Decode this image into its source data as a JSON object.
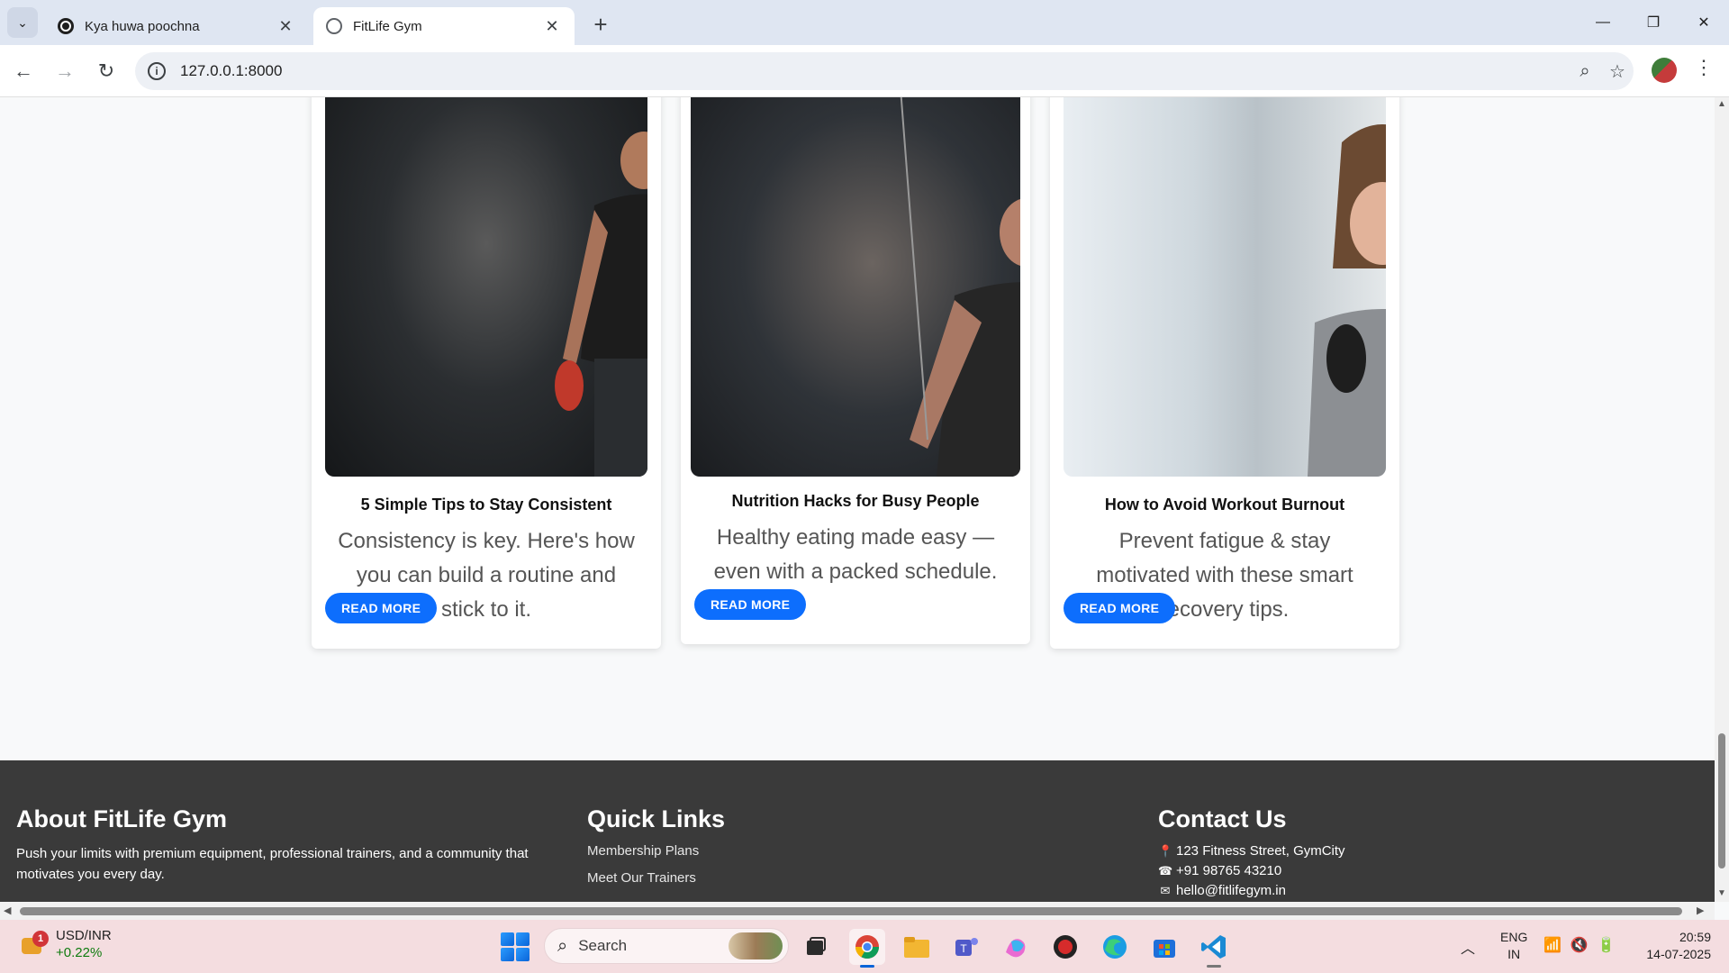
{
  "browser": {
    "tabs": [
      {
        "title": "Kya huwa poochna"
      },
      {
        "title": "FitLife Gym"
      }
    ],
    "url": "127.0.0.1:8000"
  },
  "blog_cards": [
    {
      "title": "5 Simple Tips to Stay Consistent",
      "text": "Consistency is key. Here's how you can build a routine and stick to it.",
      "button": "READ MORE"
    },
    {
      "title": "Nutrition Hacks for Busy People",
      "text": "Healthy eating made easy — even with a packed schedule.",
      "button": "READ MORE"
    },
    {
      "title": "How to Avoid Workout Burnout",
      "text": "Prevent fatigue & stay motivated with these smart recovery tips.",
      "button": "READ MORE"
    }
  ],
  "footer": {
    "about": {
      "heading": "About FitLife Gym",
      "text": "Push your limits with premium equipment, professional trainers, and a community that motivates you every day."
    },
    "quick_links": {
      "heading": "Quick Links",
      "items": [
        "Membership Plans",
        "Meet Our Trainers"
      ]
    },
    "contact": {
      "heading": "Contact Us",
      "address": "123 Fitness Street, GymCity",
      "phone": "+91 98765 43210",
      "email": "hello@fitlifegym.in"
    }
  },
  "taskbar": {
    "widget": {
      "badge": "1",
      "pair": "USD/INR",
      "change": "+0.22%"
    },
    "search_placeholder": "Search",
    "lang": {
      "line1": "ENG",
      "line2": "IN"
    },
    "clock": {
      "time": "20:59",
      "date": "14-07-2025"
    }
  },
  "colors": {
    "accent": "#0d6efd",
    "footer_bg": "#3a3a3a",
    "taskbar_bg": "#f4dde0"
  }
}
